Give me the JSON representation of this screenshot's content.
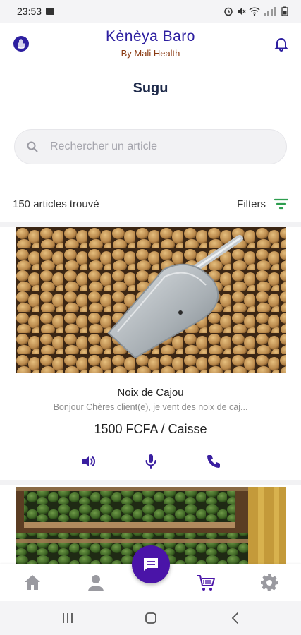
{
  "status_bar": {
    "time": "23:53"
  },
  "header": {
    "title": "Kènèya Baro",
    "subtitle": "By Mali Health"
  },
  "page": {
    "title": "Sugu"
  },
  "search": {
    "placeholder": "Rechercher un article"
  },
  "results": {
    "count_label": "150 articles trouvé",
    "filters_label": "Filters"
  },
  "products": [
    {
      "name": "Noix de Cajou",
      "description": "Bonjour Chères client(e), je vent des noix de caj...",
      "price": "1500 FCFA / Caisse"
    }
  ],
  "colors": {
    "brand": "#2d1fa0",
    "subtitle": "#8a3a12",
    "accent_green": "#2e9e4f",
    "fab": "#4a14a8",
    "icon_purple": "#3a1fa0"
  }
}
